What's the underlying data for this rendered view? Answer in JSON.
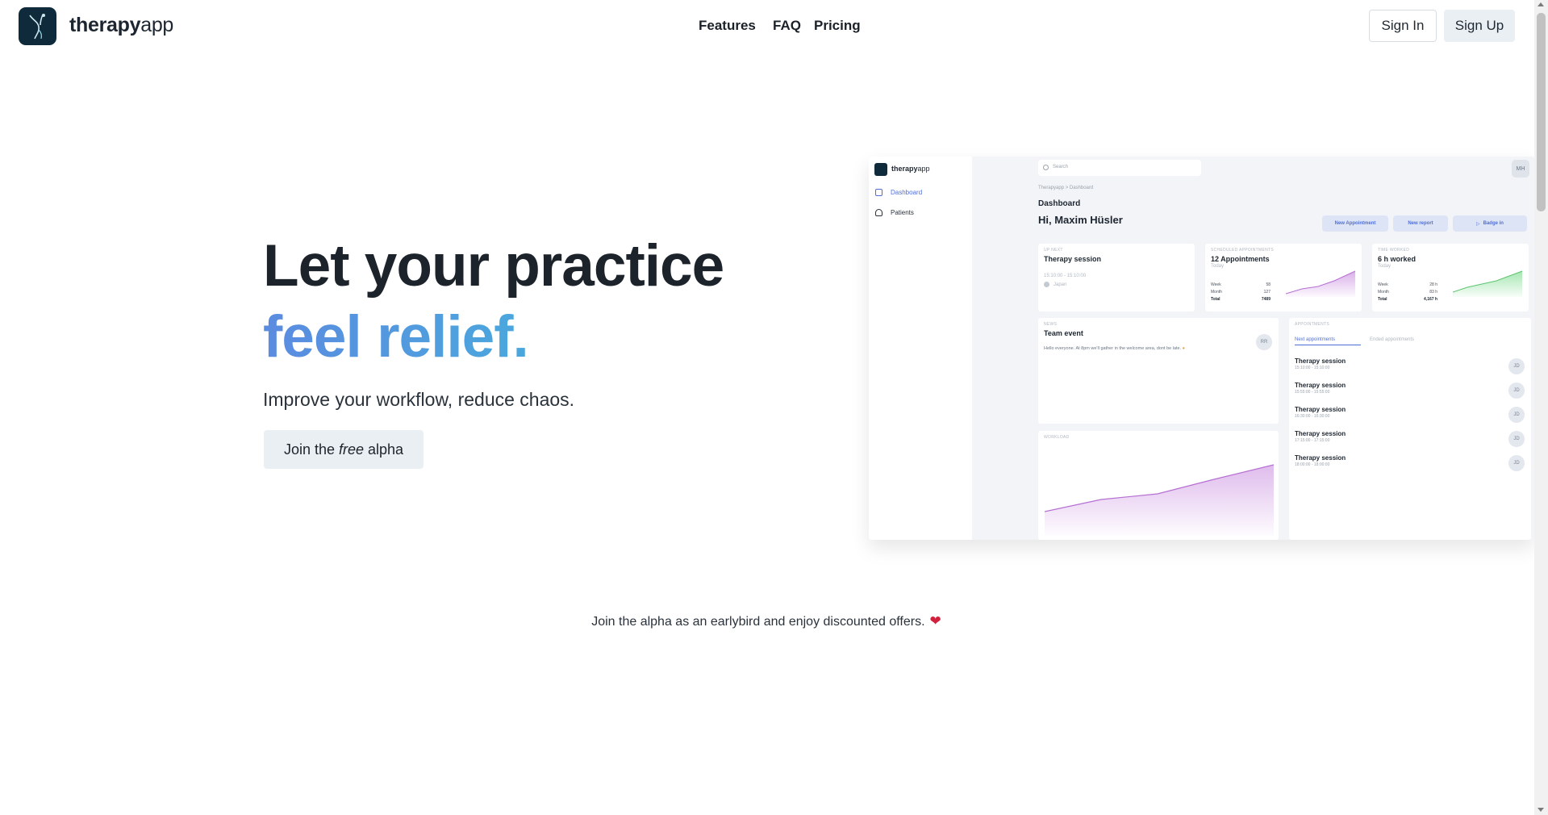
{
  "brand": {
    "bold": "therapy",
    "light": "app"
  },
  "nav": {
    "features": "Features",
    "faq": "FAQ",
    "pricing": "Pricing"
  },
  "auth": {
    "sign_in": "Sign In",
    "sign_up": "Sign Up"
  },
  "hero": {
    "line1": "Let your practice",
    "line2": "feel relief.",
    "subtitle": "Improve your workflow, reduce chaos.",
    "cta_prefix": "Join the",
    "cta_emphasis": "free",
    "cta_suffix": "alpha"
  },
  "earlybird": "Join the alpha as an earlybird and enjoy discounted offers.",
  "colors": {
    "accent_start": "#5b8be0",
    "accent_end": "#4aa8dd",
    "heart": "#d0223f",
    "preview_accent": "#4f6fd8"
  },
  "preview": {
    "brand_bold": "therapy",
    "brand_light": "app",
    "sidebar": [
      "Dashboard",
      "Patients"
    ],
    "search_placeholder": "Search",
    "avatar": "MH",
    "breadcrumb": "Therapyapp  >  Dashboard",
    "title": "Dashboard",
    "greeting": "Hi, Maxim Hüsler",
    "buttons": [
      "New Appointment",
      "New report",
      "Badge in"
    ],
    "up_next": {
      "caption": "UP NEXT",
      "title": "Therapy session",
      "time": "15:10:00 - 15:10:00",
      "location": "Japan"
    },
    "scheduled": {
      "caption": "SCHEDULED APPOINTMENTS",
      "title": "12 Appointments",
      "sub": "Today",
      "rows": [
        [
          "Week",
          "58"
        ],
        [
          "Month",
          "127"
        ],
        [
          "Total",
          "7489"
        ]
      ]
    },
    "time_worked": {
      "caption": "TIME WORKED",
      "title": "6 h worked",
      "sub": "Today",
      "rows": [
        [
          "Week",
          "28 h"
        ],
        [
          "Month",
          "83 h"
        ],
        [
          "Total",
          "4,167 h"
        ]
      ]
    },
    "news": {
      "caption": "NEWS",
      "title": "Team event",
      "body": "Hello everyone. At 8pm we'll gather in the welcome area, dont be late.",
      "avatar": "RR"
    },
    "workload": {
      "caption": "WORKLOAD"
    },
    "appointments": {
      "caption": "APPOINTMENTS",
      "tabs": [
        "Next appointments",
        "Ended appointments"
      ],
      "items": [
        {
          "title": "Therapy session",
          "time": "15:10:00 - 15:10:00",
          "avatar": "JD"
        },
        {
          "title": "Therapy session",
          "time": "15:55:00 - 15:55:00",
          "avatar": "JD"
        },
        {
          "title": "Therapy session",
          "time": "16:30:00 - 16:30:00",
          "avatar": "JD"
        },
        {
          "title": "Therapy session",
          "time": "17:15:00 - 17:15:00",
          "avatar": "JD"
        },
        {
          "title": "Therapy session",
          "time": "18:00:00 - 18:00:00",
          "avatar": "JD"
        }
      ]
    }
  }
}
